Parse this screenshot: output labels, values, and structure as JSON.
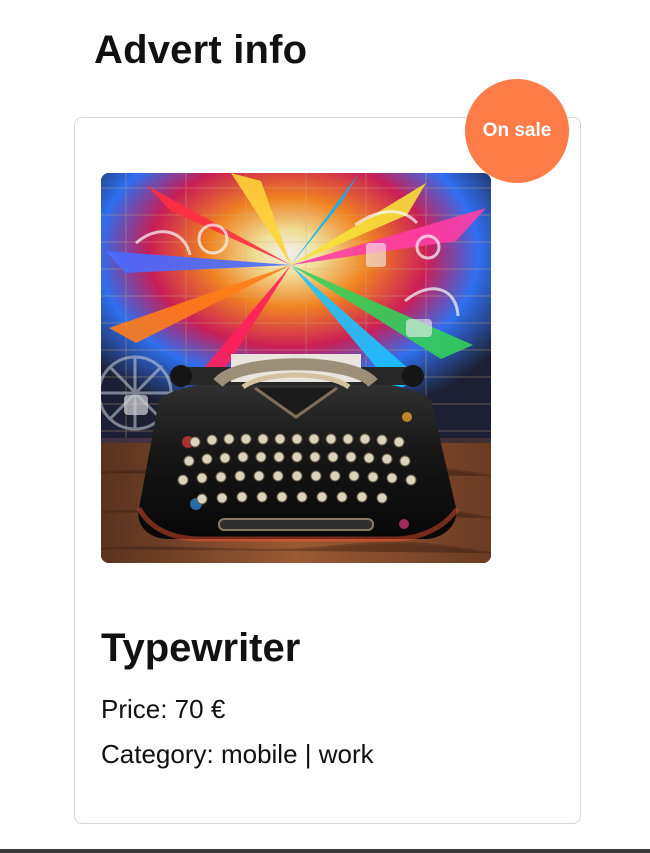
{
  "page": {
    "title": "Advert info"
  },
  "advert": {
    "badge": "On sale",
    "name": "Typewriter",
    "price_label": "Price: 70 €",
    "category_label": "Category: mobile | work"
  },
  "colors": {
    "badge_background": "#ff7b47",
    "text": "#111111",
    "card_border": "#d6d6d6"
  }
}
